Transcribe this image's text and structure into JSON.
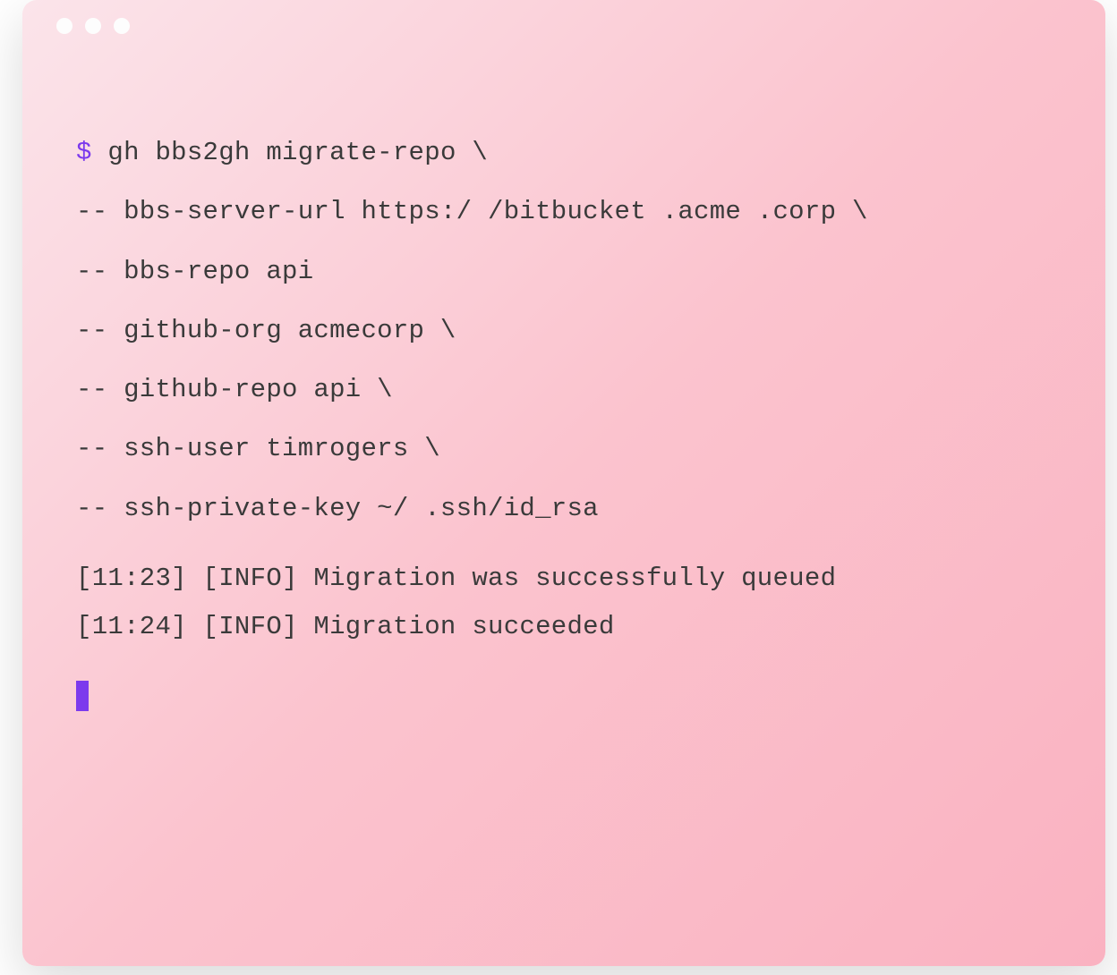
{
  "colors": {
    "prompt": "#7c3aed",
    "cursor": "#7c3aed",
    "text": "#3a3a3a",
    "bg_gradient_start": "#fbe4ea",
    "bg_gradient_end": "#fab2c1",
    "traffic_dot": "#fdfdfd"
  },
  "terminal": {
    "prompt_symbol": "$",
    "command_lines": [
      {
        "prefix": "$ ",
        "text": "gh bbs2gh migrate-repo \\"
      },
      {
        "prefix": "",
        "text": "-- bbs-server-url https:/ /bitbucket .acme .corp \\"
      },
      {
        "prefix": "",
        "text": "-- bbs-repo api"
      },
      {
        "prefix": "",
        "text": "-- github-org acmecorp \\"
      },
      {
        "prefix": "",
        "text": "-- github-repo api \\"
      },
      {
        "prefix": "",
        "text": "-- ssh-user timrogers \\"
      },
      {
        "prefix": "",
        "text": "-- ssh-private-key ~/ .ssh/id_rsa"
      }
    ],
    "output_lines": [
      "[11:23] [INFO] Migration was successfully queued",
      "[11:24] [INFO] Migration succeeded"
    ]
  }
}
